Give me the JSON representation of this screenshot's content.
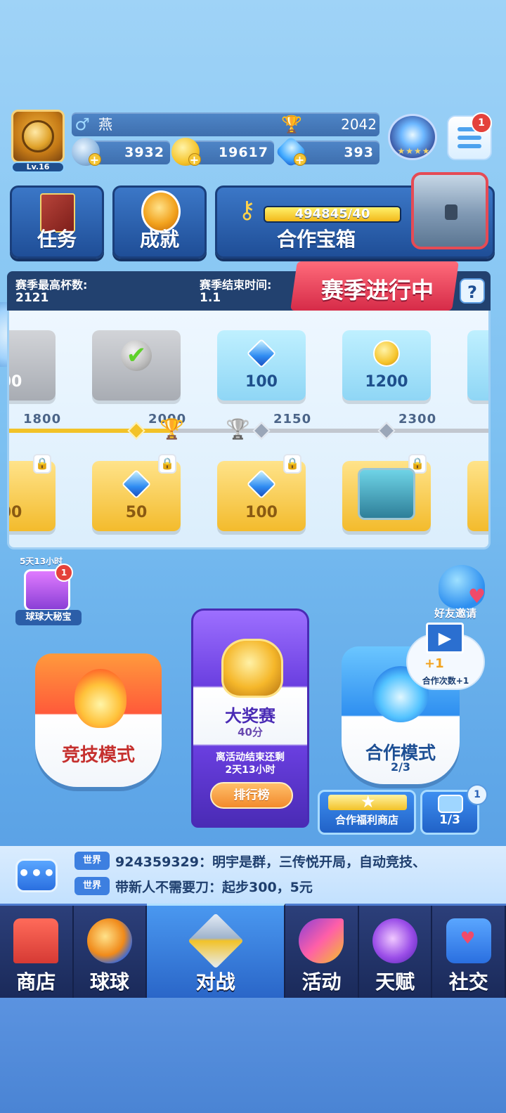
{
  "player": {
    "name": "燕",
    "level": "Lv.16",
    "gender_icon": "♂",
    "trophies": "2042",
    "energy": "3932",
    "gold": "19617",
    "gems": "393",
    "menu_badge": "1"
  },
  "tiles": {
    "tasks": "任务",
    "achievements": "成就",
    "coop_chest": "合作宝箱",
    "coop_progress_text": "494845/40",
    "coop_progress_fraction": 1.0
  },
  "season": {
    "max_cups_label": "赛季最高杯数:",
    "max_cups_value": "2121",
    "end_time_label": "赛季结束时间:",
    "end_time_value": "1.1",
    "status": "赛季进行中",
    "help": "?",
    "ticks": [
      "1800",
      "2000",
      "2150",
      "2300"
    ],
    "free_rewards": [
      {
        "value": "00",
        "kind": "claimed"
      },
      {
        "value": "",
        "kind": "check"
      },
      {
        "value": "100",
        "kind": "gem"
      },
      {
        "value": "1200",
        "kind": "coin"
      }
    ],
    "premium_rewards": [
      {
        "value": "00",
        "kind": "coin"
      },
      {
        "value": "50",
        "kind": "gem"
      },
      {
        "value": "100",
        "kind": "gem"
      },
      {
        "value": "",
        "kind": "chest"
      }
    ]
  },
  "events": {
    "treasure_timer": "5天13小时",
    "treasure_label": "球球大秘宝",
    "treasure_badge": "1",
    "friend_invite": "好友邀请"
  },
  "modes": {
    "competitive": "竞技模式",
    "grand_prix": {
      "title": "大奖赛",
      "points": "40分",
      "end_line1": "离活动结束还剩",
      "end_line2": "2天13小时",
      "ranking": "排行榜"
    },
    "coop": {
      "title": "合作模式",
      "count": "2/3",
      "bubble_plus": "+1",
      "bubble_text": "合作次数+1"
    },
    "coop_shop": "合作福利商店",
    "boost_count": "1/3",
    "boost_badge": "1"
  },
  "chat": {
    "button": "•••",
    "tag": "世界",
    "messages": [
      "924359329：明宇是群，三传悦开局，自动竞技、",
      "带新人不需要刀：起步300，5元"
    ]
  },
  "nav": [
    {
      "label": "商店",
      "icon": "shop-icon"
    },
    {
      "label": "球球",
      "icon": "balls-icon"
    },
    {
      "label": "对战",
      "icon": "battle-icon",
      "active": true
    },
    {
      "label": "活动",
      "icon": "event-icon"
    },
    {
      "label": "天赋",
      "icon": "talent-icon"
    },
    {
      "label": "社交",
      "icon": "social-icon"
    }
  ]
}
